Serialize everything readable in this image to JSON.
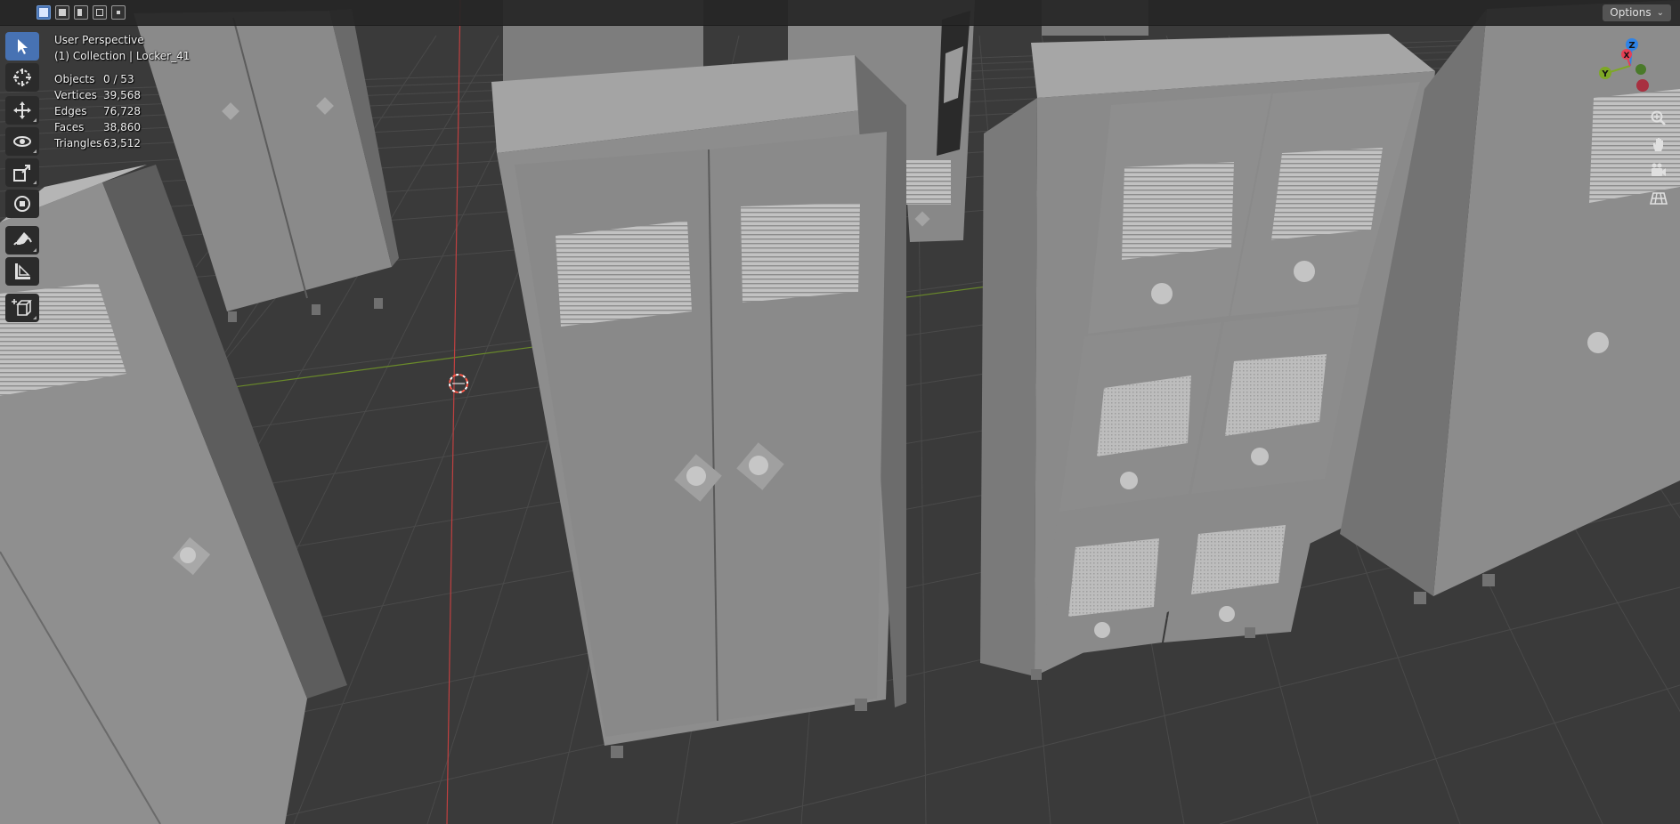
{
  "header": {
    "options_label": "Options",
    "options_icon": "chevron-down-icon",
    "select_modes": [
      "select-new-icon",
      "select-extend-icon",
      "select-subtract-icon",
      "select-invert-icon",
      "select-intersect-icon"
    ]
  },
  "overlay": {
    "view_name": "User Perspective",
    "collection": "(1) Collection | Locker_41",
    "stats": [
      {
        "label": "Objects",
        "value": "0 / 53"
      },
      {
        "label": "Vertices",
        "value": "39,568"
      },
      {
        "label": "Edges",
        "value": "76,728"
      },
      {
        "label": "Faces",
        "value": "38,860"
      },
      {
        "label": "Triangles",
        "value": "63,512"
      }
    ]
  },
  "toolbar": {
    "tools": [
      "select-box-icon",
      "cursor-icon",
      "move-icon",
      "rotate-icon",
      "scale-icon",
      "transform-icon",
      "annotate-icon",
      "measure-icon",
      "add-cube-icon"
    ]
  },
  "gizmo": {
    "axis_labels": [
      "Z",
      "Y",
      "X"
    ],
    "axis_colors": {
      "x": "#e64054",
      "y": "#7ea826",
      "z": "#2f83e6"
    }
  },
  "nav": {
    "buttons": [
      "zoom-icon",
      "pan-hand-icon",
      "camera-icon",
      "grid-view-icon"
    ]
  },
  "colors": {
    "grid": "#3a3a3a",
    "object": "#8b8b8b",
    "active": "#4772b3",
    "axis_red": "#e64054",
    "axis_green": "#7ea826"
  }
}
